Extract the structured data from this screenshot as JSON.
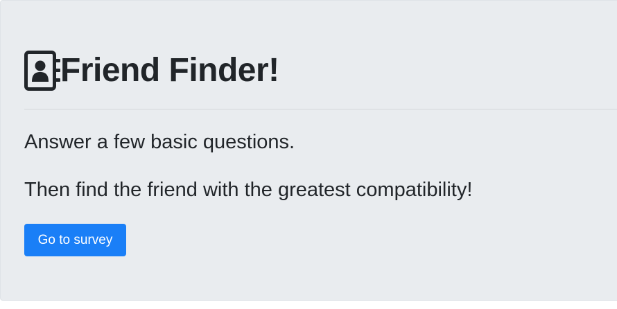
{
  "header": {
    "icon": "address-book-icon",
    "title": "Friend Finder!"
  },
  "main": {
    "lead_1": "Answer a few basic questions.",
    "lead_2": "Then find the friend with the greatest compatibility!",
    "survey_button_label": "Go to survey"
  },
  "colors": {
    "background": "#e9ecef",
    "text": "#212529",
    "button": "#1a7ff7",
    "button_text": "#ffffff"
  }
}
